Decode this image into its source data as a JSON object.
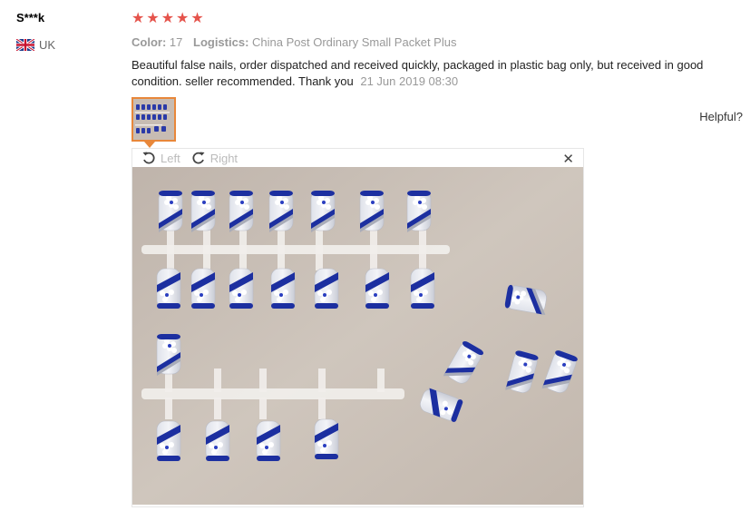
{
  "reviewer": {
    "name": "S***k",
    "country": "UK"
  },
  "review": {
    "rating": 5,
    "color_label": "Color:",
    "color_value": "17",
    "logistics_label": "Logistics:",
    "logistics_value": "China Post Ordinary Small Packet Plus",
    "text": "Beautiful false nails, order dispatched and received quickly, packaged in plastic bag only, but received in good condition. seller recommended. Thank you",
    "date": "21 Jun 2019 08:30"
  },
  "helpful_label": "Helpful?",
  "viewer": {
    "rotate_left_label": "Left",
    "rotate_right_label": "Right",
    "close_symbol": "✕"
  },
  "colors": {
    "star": "#e5534b",
    "thumb_border": "#e8873a",
    "nail_blue": "#1c2fa0",
    "background_photo": "#cbc1b8"
  },
  "icons": [
    "uk-flag-icon",
    "star-icon",
    "rotate-left-icon",
    "rotate-right-icon",
    "close-icon"
  ]
}
